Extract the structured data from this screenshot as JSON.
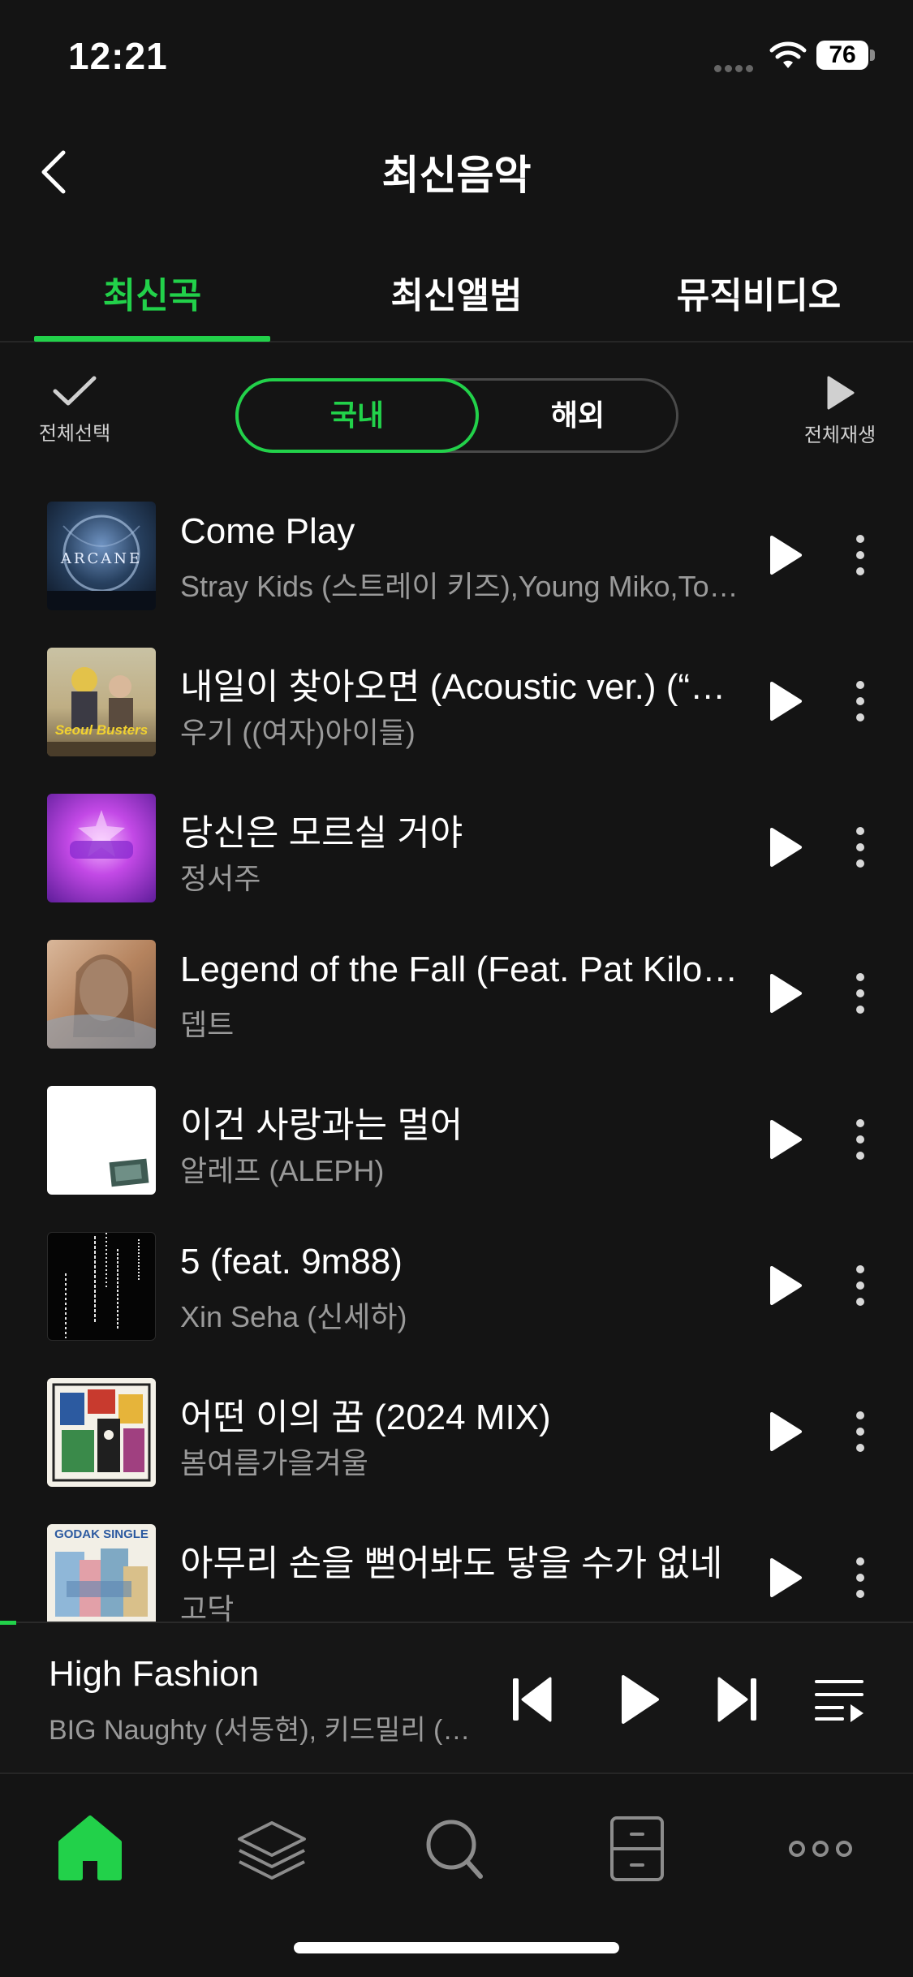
{
  "status_bar": {
    "time": "12:21",
    "battery": "76"
  },
  "header": {
    "title": "최신음악"
  },
  "tabs": [
    {
      "label": "최신곡",
      "active": true
    },
    {
      "label": "최신앨범",
      "active": false
    },
    {
      "label": "뮤직비디오",
      "active": false
    }
  ],
  "controls": {
    "select_all_label": "전체선택",
    "segment": {
      "domestic": "국내",
      "foreign": "해외",
      "selected": "국내"
    },
    "play_all_label": "전체재생"
  },
  "songs": [
    {
      "title": "Come Play",
      "artist": "Stray Kids (스트레이 키즈),Young Miko,Tom Morello",
      "art_text": "ARCANE"
    },
    {
      "title": "내일이 찾아오면 (Acoustic ver.) (“서울버스터즈” OST)",
      "artist": "우기 ((여자)아이들)",
      "art_text": "Seoul Busters"
    },
    {
      "title": "당신은 모르실 거야",
      "artist": "정서주",
      "art_text": ""
    },
    {
      "title": "Legend of the Fall (Feat. Pat Kiloran)",
      "artist": "뎁트",
      "art_text": ""
    },
    {
      "title": "이건 사랑과는 멀어",
      "artist": "알레프 (ALEPH)",
      "art_text": ""
    },
    {
      "title": "5 (feat. 9m88)",
      "artist": "Xin Seha (신세하)",
      "art_text": ""
    },
    {
      "title": "어떤 이의 꿈 (2024 MIX)",
      "artist": "봄여름가을겨울",
      "art_text": ""
    },
    {
      "title": "아무리 손을 뻗어봐도 닿을 수가 없네",
      "artist": "고닥",
      "art_text": "GODAK SINGLE"
    }
  ],
  "now_playing": {
    "title": "High Fashion",
    "artist": "BIG Naughty (서동현), 키드밀리 (Kid Milli)",
    "progress": 0.018
  },
  "bottom_nav": [
    "home-icon",
    "layers-icon",
    "search-icon",
    "drawer-icon",
    "more-icon"
  ],
  "colors": {
    "accent": "#22d14a",
    "background": "#141414",
    "secondary_text": "#9a9a9a"
  }
}
